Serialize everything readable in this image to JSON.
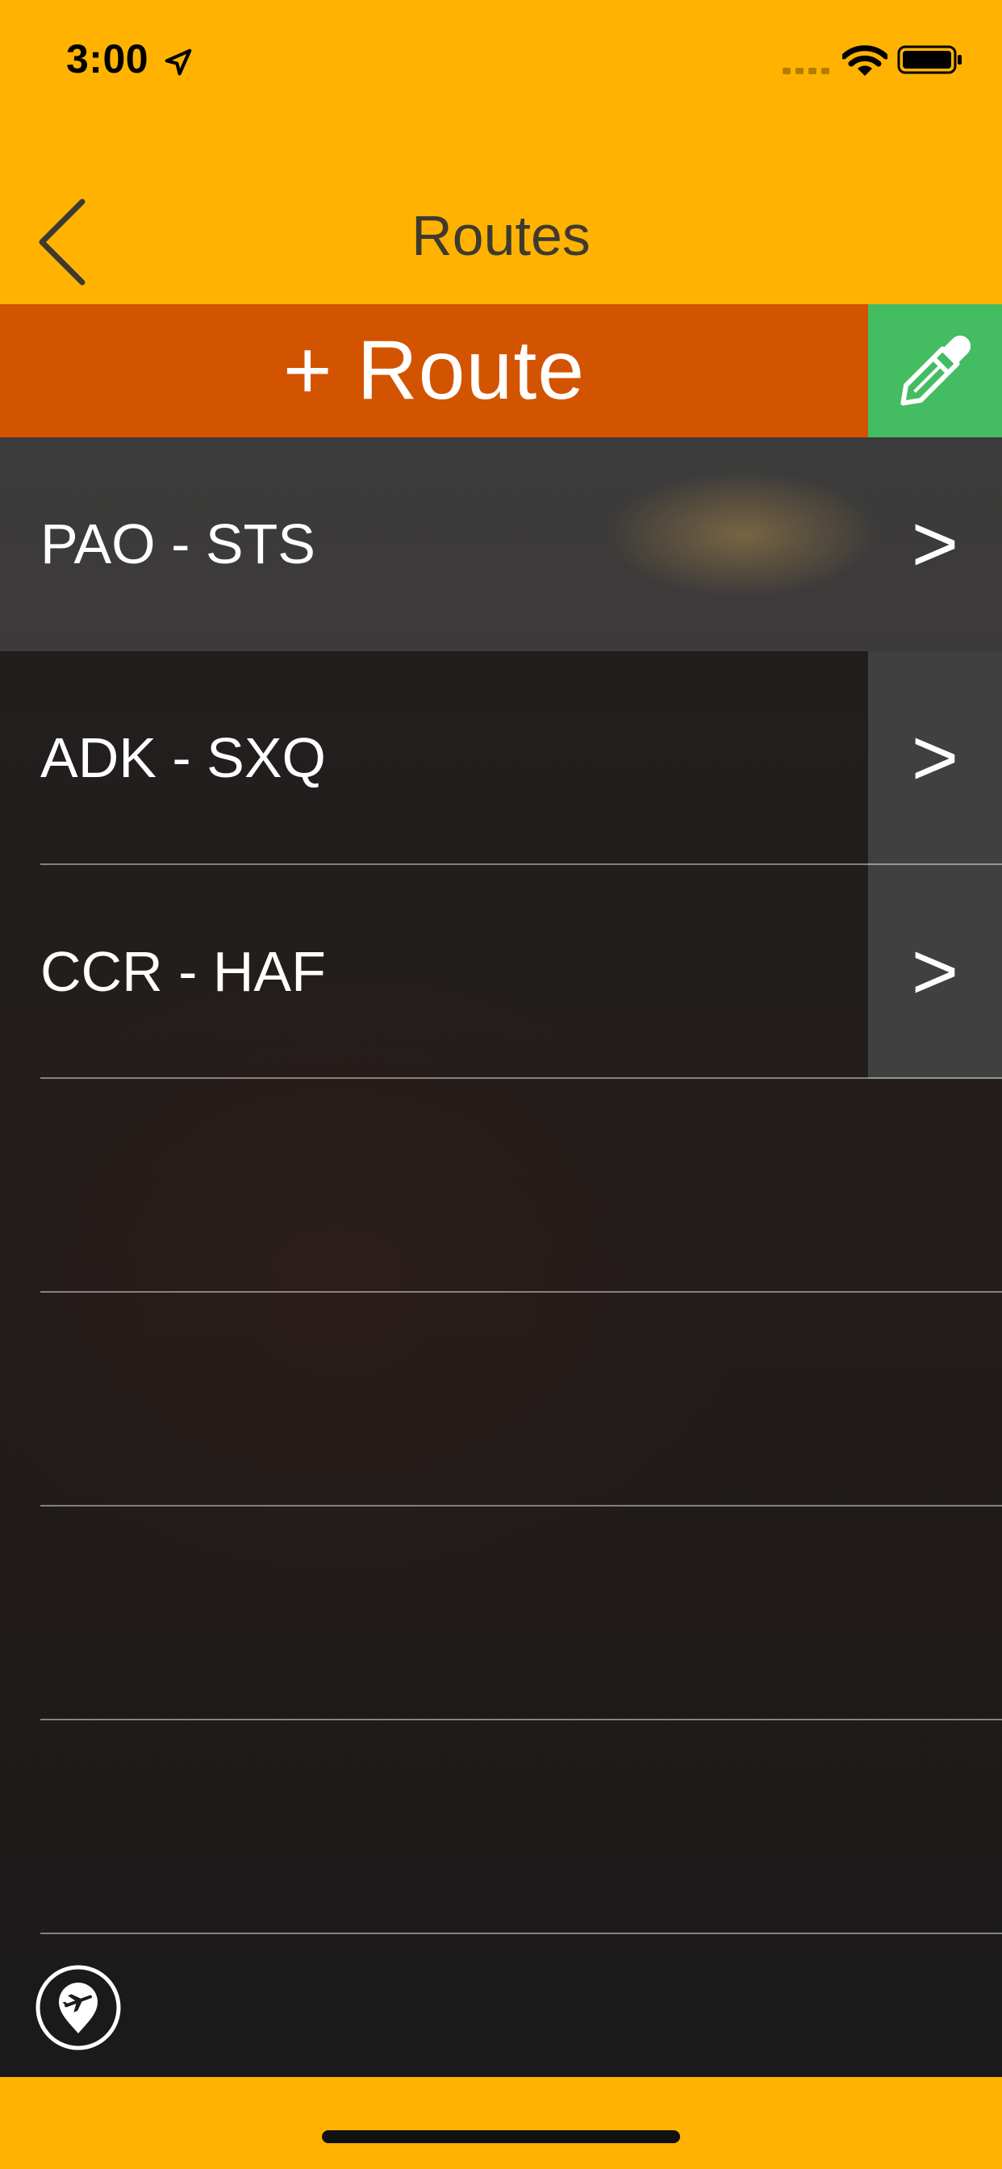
{
  "status_bar": {
    "time": "3:00"
  },
  "nav": {
    "title": "Routes"
  },
  "actions": {
    "add_route_label": "+ Route"
  },
  "routes": [
    {
      "label": "PAO - STS",
      "chevron": ">",
      "selected": true
    },
    {
      "label": "ADK - SXQ",
      "chevron": ">"
    },
    {
      "label": "CCR - HAF",
      "chevron": ">"
    }
  ],
  "icons": {
    "back": "chevron-left-icon",
    "edit": "pencil-icon",
    "location": "location-arrow-icon",
    "map_pin": "airplane-pin-icon"
  },
  "colors": {
    "header": "#FFB300",
    "add_bar": "#D35400",
    "edit_button": "#43BC62",
    "list_background": "#1c1c1c"
  }
}
